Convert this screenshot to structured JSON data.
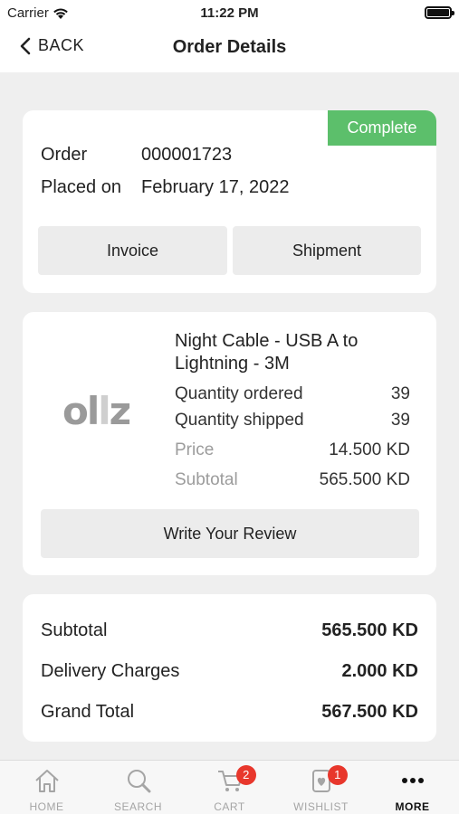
{
  "status_bar": {
    "carrier": "Carrier",
    "time": "11:22 PM"
  },
  "nav": {
    "back_label": "BACK",
    "title": "Order Details"
  },
  "order": {
    "status": "Complete",
    "order_label": "Order",
    "order_number": "000001723",
    "placed_label": "Placed on",
    "placed_date": "February 17, 2022",
    "invoice_button": "Invoice",
    "shipment_button": "Shipment"
  },
  "item": {
    "logo_text_a": "ol",
    "logo_text_b": "l",
    "logo_text_c": "z",
    "name": "Night Cable - USB A to Lightning - 3M",
    "qty_ordered_label": "Quantity ordered",
    "qty_ordered": "39",
    "qty_shipped_label": "Quantity shipped",
    "qty_shipped": "39",
    "price_label": "Price",
    "price": "14.500 KD",
    "subtotal_label": "Subtotal",
    "subtotal": "565.500 KD",
    "review_button": "Write Your Review"
  },
  "totals": {
    "subtotal_label": "Subtotal",
    "subtotal": "565.500 KD",
    "delivery_label": "Delivery Charges",
    "delivery": "2.000 KD",
    "grand_label": "Grand Total",
    "grand": "567.500 KD"
  },
  "tabs": [
    {
      "label": "HOME",
      "icon": "home-icon"
    },
    {
      "label": "SEARCH",
      "icon": "search-icon"
    },
    {
      "label": "CART",
      "icon": "cart-icon",
      "badge": "2"
    },
    {
      "label": "WISHLIST",
      "icon": "wishlist-icon",
      "badge": "1"
    },
    {
      "label": "MORE",
      "icon": "more-icon"
    }
  ],
  "colors": {
    "complete_badge": "#5cbf6b",
    "tab_badge": "#e8372c",
    "background": "#efefef"
  }
}
